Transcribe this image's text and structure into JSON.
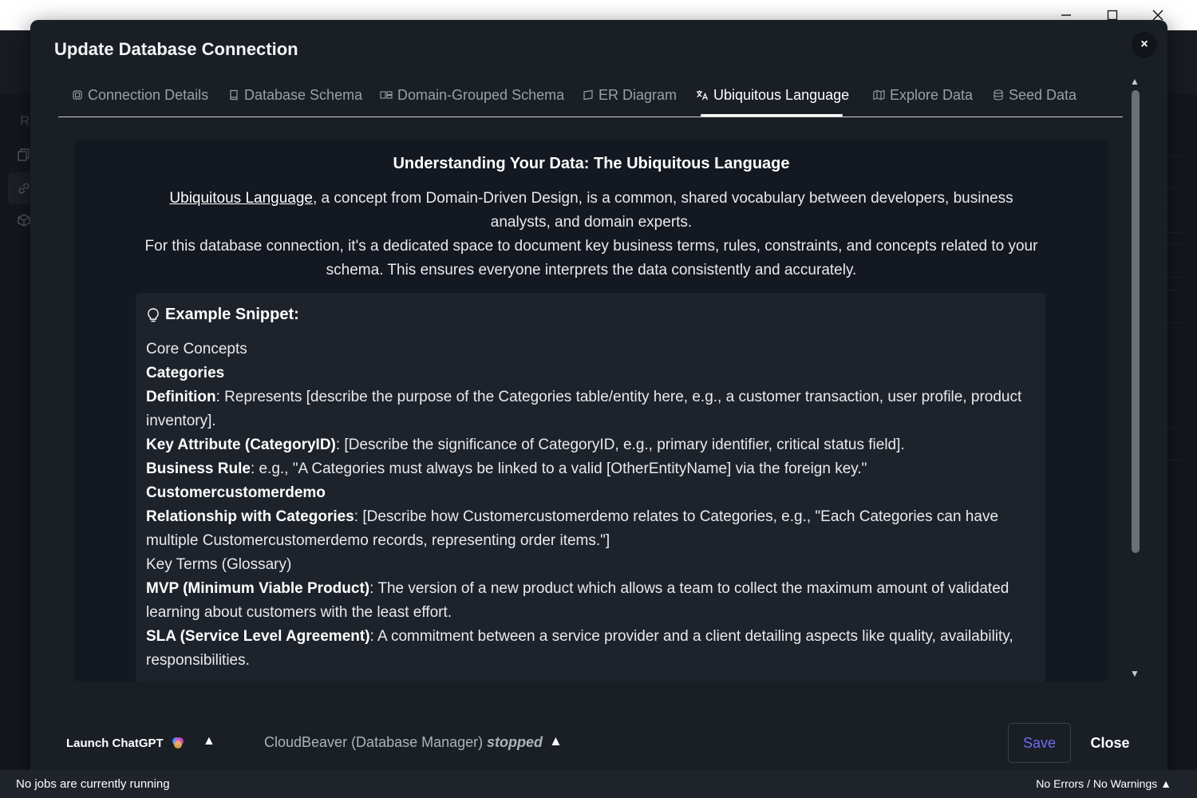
{
  "window": {
    "min_icon": "minimize-icon",
    "max_icon": "maximize-icon",
    "close_icon": "close-icon"
  },
  "background": {
    "sidebar_label": "R"
  },
  "modal": {
    "title": "Update Database Connection",
    "close_symbol": "×"
  },
  "tabs": [
    {
      "label": "Connection Details",
      "icon": "connection-icon",
      "active": false
    },
    {
      "label": "Database Schema",
      "icon": "book-icon",
      "active": false
    },
    {
      "label": "Domain-Grouped Schema",
      "icon": "group-icon",
      "active": false
    },
    {
      "label": "ER Diagram",
      "icon": "diagram-icon",
      "active": false
    },
    {
      "label": "Ubiquitous Language",
      "icon": "translate-icon",
      "active": true
    },
    {
      "label": "Explore Data",
      "icon": "map-icon",
      "active": false
    },
    {
      "label": "Seed Data",
      "icon": "database-icon",
      "active": false
    }
  ],
  "content": {
    "heading": "Understanding Your Data: The Ubiquitous Language",
    "intro_link": "Ubiquitous Language",
    "intro_p1_rest": ", a concept from Domain-Driven Design, is a common, shared vocabulary between developers, business analysts, and domain experts.",
    "intro_p2": "For this database connection, it's a dedicated space to document key business terms, rules, constraints, and concepts related to your schema. This ensures everyone interprets the data consistently and accurately.",
    "snippet": {
      "title": "Example Snippet:",
      "core_concepts": "Core Concepts",
      "entity1": "Categories",
      "definition_label": "Definition",
      "definition_text": ": Represents [describe the purpose of the Categories table/entity here, e.g., a customer transaction, user profile, product inventory].",
      "key_attr_label": "Key Attribute (CategoryID)",
      "key_attr_text": ": [Describe the significance of CategoryID, e.g., primary identifier, critical status field].",
      "rule_label": "Business Rule",
      "rule_text": ": e.g., \"A Categories must always be linked to a valid [OtherEntityName] via the foreign key.\"",
      "entity2": "Customercustomerdemo",
      "rel_label": "Relationship with Categories",
      "rel_text": ": [Describe how Customercustomerdemo relates to Categories, e.g., \"Each Categories can have multiple Customercustomerdemo records, representing order items.\"]",
      "glossary": "Key Terms (Glossary)",
      "mvp_label": "MVP (Minimum Viable Product)",
      "mvp_text": ": The version of a new product which allows a team to collect the maximum amount of validated learning about customers with the least effort.",
      "sla_label": "SLA (Service Level Agreement)",
      "sla_text": ": A commitment between a service provider and a client detailing aspects like quality, availability, responsibilities."
    }
  },
  "footer": {
    "chatgpt_label": "Launch ChatGPT",
    "caret": "▲",
    "cloudbeaver_label": "CloudBeaver (Database Manager)",
    "cloudbeaver_status": "stopped",
    "save_label": "Save",
    "close_label": "Close"
  },
  "statusbar": {
    "jobs": "No jobs are currently running",
    "problems": "No Errors / No Warnings ▲"
  },
  "colors": {
    "accent": "#6e6cf0",
    "modal_bg": "#1a1e25",
    "card_bg": "#141820"
  }
}
